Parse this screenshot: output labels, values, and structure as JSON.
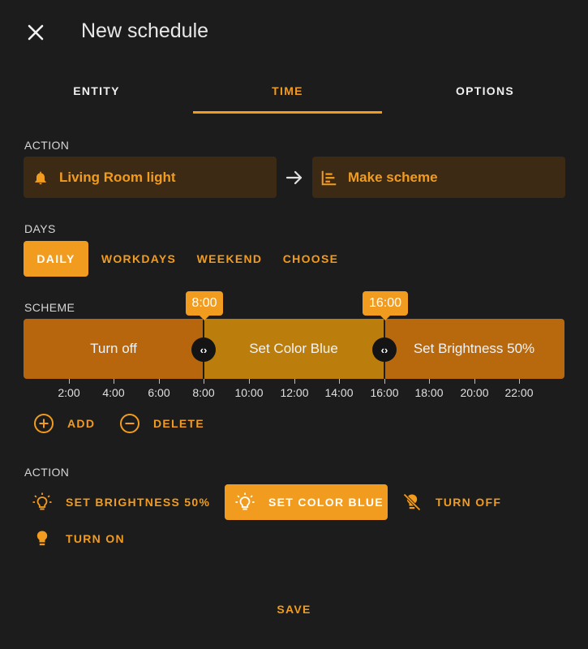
{
  "header": {
    "title": "New schedule"
  },
  "tabs": [
    {
      "label": "ENTITY",
      "active": false
    },
    {
      "label": "TIME",
      "active": true
    },
    {
      "label": "OPTIONS",
      "active": false
    }
  ],
  "action_section": {
    "label": "ACTION",
    "entity": {
      "label": "Living Room light",
      "icon": "bell-icon"
    },
    "arrow_icon": "arrow-right-icon",
    "mode": {
      "label": "Make scheme",
      "icon": "chart-timeline-icon"
    }
  },
  "days": {
    "label": "DAYS",
    "options": [
      {
        "label": "DAILY",
        "active": true
      },
      {
        "label": "WORKDAYS",
        "active": false
      },
      {
        "label": "WEEKEND",
        "active": false
      },
      {
        "label": "CHOOSE",
        "active": false
      }
    ]
  },
  "scheme": {
    "label": "SCHEME",
    "segments": [
      {
        "label": "Turn off"
      },
      {
        "label": "Set Color Blue"
      },
      {
        "label": "Set Brightness 50%"
      }
    ],
    "markers": [
      {
        "time": "8:00"
      },
      {
        "time": "16:00"
      }
    ],
    "ticks": [
      "2:00",
      "4:00",
      "6:00",
      "8:00",
      "10:00",
      "12:00",
      "14:00",
      "16:00",
      "18:00",
      "20:00",
      "22:00"
    ],
    "handle_glyph": "‹›",
    "add_label": "ADD",
    "delete_label": "DELETE"
  },
  "actions": {
    "label": "ACTION",
    "items": [
      {
        "label": "SET BRIGHTNESS 50%",
        "icon": "lightbulb-on-outline-icon",
        "active": false
      },
      {
        "label": "SET COLOR BLUE",
        "icon": "lightbulb-on-outline-icon",
        "active": true
      },
      {
        "label": "TURN OFF",
        "icon": "lightbulb-off-icon",
        "active": false
      },
      {
        "label": "TURN ON",
        "icon": "lightbulb-icon",
        "active": false
      }
    ]
  },
  "footer": {
    "save_label": "SAVE"
  },
  "colors": {
    "accent": "#f29c1f",
    "background": "#1c1c1c",
    "chip_background": "#3d2a15"
  }
}
